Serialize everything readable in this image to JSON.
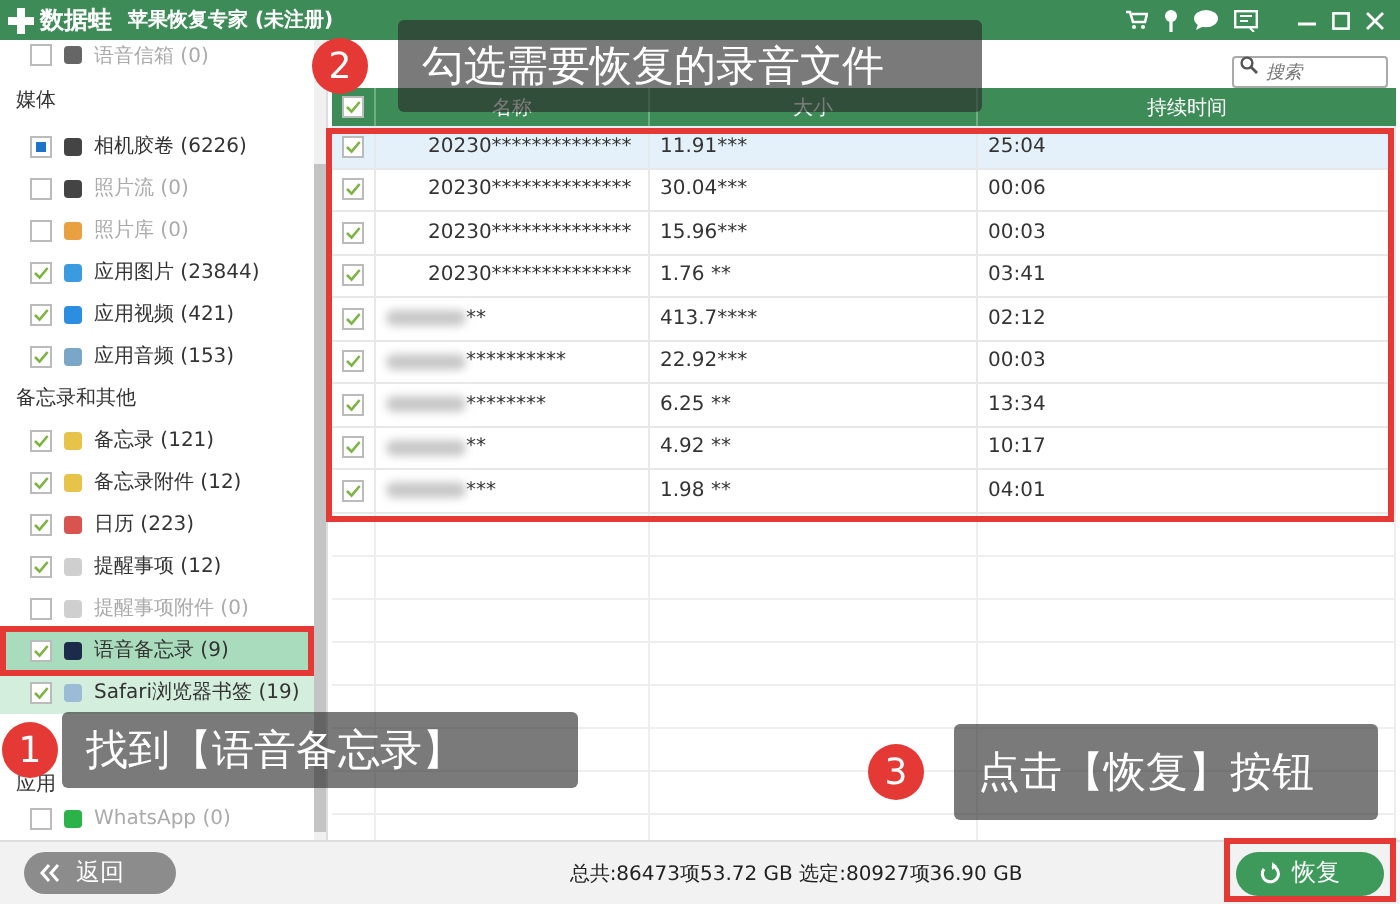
{
  "title_bar": {
    "logo": "数据蛙",
    "title": "苹果恢复专家 (未注册)"
  },
  "sidebar": {
    "sections": [
      {
        "items": [
          {
            "label": "语音信箱 (0)",
            "checked": false,
            "disabled": true,
            "selected": false,
            "highlighted": false
          }
        ]
      },
      {
        "header": "媒体",
        "items": [
          {
            "label": "相机胶卷 (6226)",
            "partial": true,
            "disabled": false,
            "selected": false,
            "highlighted": false
          },
          {
            "label": "照片流 (0)",
            "checked": false,
            "disabled": true,
            "selected": false,
            "highlighted": false
          },
          {
            "label": "照片库 (0)",
            "checked": false,
            "disabled": true,
            "selected": false,
            "highlighted": false
          },
          {
            "label": "应用图片 (23844)",
            "checked": true,
            "disabled": false,
            "selected": false,
            "highlighted": false
          },
          {
            "label": "应用视频 (421)",
            "checked": true,
            "disabled": false,
            "selected": false,
            "highlighted": false
          },
          {
            "label": "应用音频 (153)",
            "checked": true,
            "disabled": false,
            "selected": false,
            "highlighted": false
          }
        ]
      },
      {
        "header": "备忘录和其他",
        "items": [
          {
            "label": "备忘录 (121)",
            "checked": true,
            "disabled": false,
            "selected": false,
            "highlighted": false
          },
          {
            "label": "备忘录附件 (12)",
            "checked": true,
            "disabled": false,
            "selected": false,
            "highlighted": false
          },
          {
            "label": "日历 (223)",
            "checked": true,
            "disabled": false,
            "selected": false,
            "highlighted": false
          },
          {
            "label": "提醒事项 (12)",
            "checked": true,
            "disabled": false,
            "selected": false,
            "highlighted": false
          },
          {
            "label": "提醒事项附件 (0)",
            "checked": false,
            "disabled": true,
            "selected": false,
            "highlighted": false
          },
          {
            "label": "语音备忘录 (9)",
            "checked": true,
            "disabled": false,
            "selected": true,
            "highlighted": false
          },
          {
            "label": "Safari浏览器书签 (19)",
            "checked": true,
            "disabled": false,
            "selected": false,
            "highlighted": true
          }
        ]
      },
      {
        "header": "应用",
        "items": [
          {
            "label": "WhatsApp (0)",
            "checked": false,
            "disabled": true,
            "selected": false,
            "highlighted": false
          }
        ]
      }
    ]
  },
  "search": {
    "placeholder": "搜索"
  },
  "table": {
    "all_checked": true,
    "columns": [
      "名称",
      "大小",
      "持续时间"
    ],
    "rows": [
      {
        "name": "20230**************",
        "size": "11.91***",
        "duration": "25:04",
        "checked": true,
        "selected": true,
        "blurred": false
      },
      {
        "name": "20230**************",
        "size": "30.04***",
        "duration": "00:06",
        "checked": true,
        "selected": false,
        "blurred": false
      },
      {
        "name": "20230**************",
        "size": "15.96***",
        "duration": "00:03",
        "checked": true,
        "selected": false,
        "blurred": false
      },
      {
        "name": "20230**************",
        "size": "1.76 **",
        "duration": "03:41",
        "checked": true,
        "selected": false,
        "blurred": false
      },
      {
        "name": "**",
        "size": "413.7****",
        "duration": "02:12",
        "checked": true,
        "selected": false,
        "blurred": true
      },
      {
        "name": "**********",
        "size": "22.92***",
        "duration": "00:03",
        "checked": true,
        "selected": false,
        "blurred": true
      },
      {
        "name": "********",
        "size": "6.25 **",
        "duration": "13:34",
        "checked": true,
        "selected": false,
        "blurred": true
      },
      {
        "name": "**",
        "size": "4.92 **",
        "duration": "10:17",
        "checked": true,
        "selected": false,
        "blurred": true
      },
      {
        "name": "***",
        "size": "1.98 **",
        "duration": "04:01",
        "checked": true,
        "selected": false,
        "blurred": true
      }
    ]
  },
  "footer": {
    "back_button": "返回",
    "status": "总共:86473项53.72 GB 选定:80927项36.90 GB",
    "restore_button": "恢复"
  },
  "callouts": [
    {
      "number": "1",
      "text": "找到【语音备忘录】"
    },
    {
      "number": "2",
      "text": "勾选需要恢复的录音文件"
    },
    {
      "number": "3",
      "text": "点击【恢复】按钮"
    }
  ]
}
